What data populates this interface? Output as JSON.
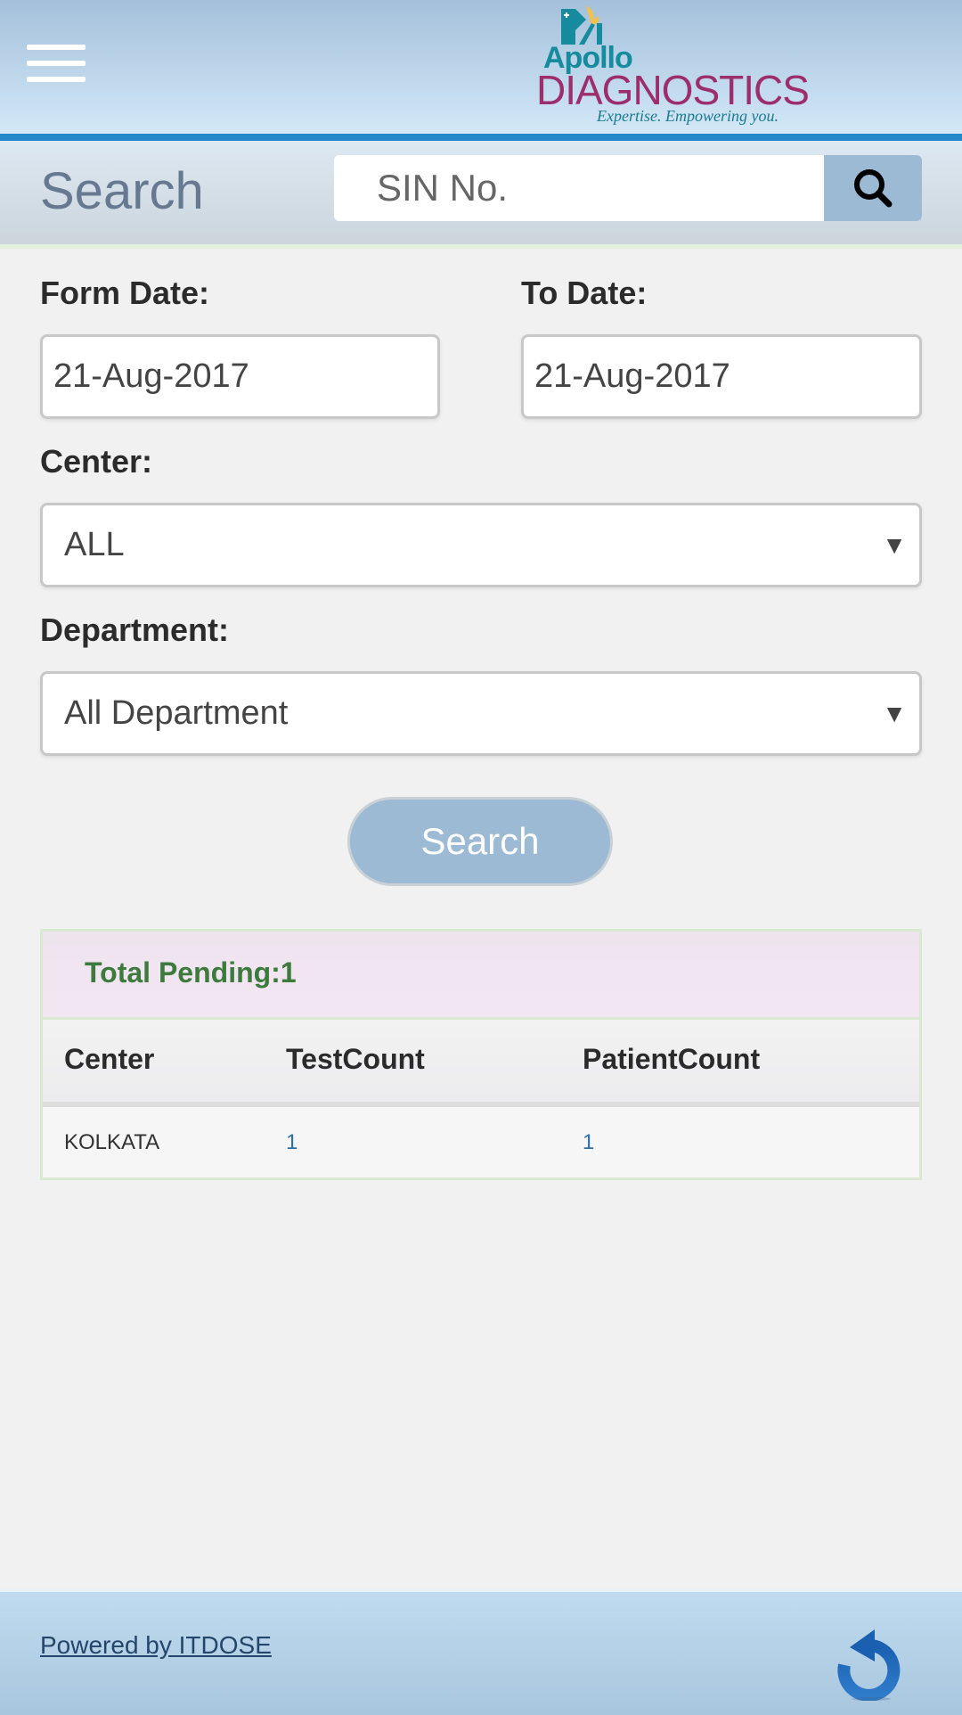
{
  "header": {
    "menu_icon": "hamburger-menu-icon",
    "logo": {
      "brand_top": "Apollo",
      "brand_main": "DIAGNOSTICS",
      "tagline": "Expertise. Empowering you.",
      "colors": {
        "teal": "#178b9e",
        "magenta": "#9d2e6c",
        "flame": "#f0c14b"
      }
    },
    "accent_bar_color": "#2389c8"
  },
  "search_strip": {
    "title": "Search",
    "sin_placeholder": "SIN No.",
    "sin_value": "",
    "search_icon": "search-icon"
  },
  "form": {
    "from_date_label": "Form Date:",
    "from_date_value": "21-Aug-2017",
    "to_date_label": "To Date:",
    "to_date_value": "21-Aug-2017",
    "center_label": "Center:",
    "center_value": "ALL",
    "department_label": "Department:",
    "department_value": "All Department",
    "dropdown_arrow": "▼",
    "search_button": "Search"
  },
  "results": {
    "total_pending": "Total Pending:1",
    "columns": [
      "Center",
      "TestCount",
      "PatientCount"
    ],
    "rows": [
      {
        "center": "KOLKATA",
        "test_count": "1",
        "patient_count": "1"
      }
    ]
  },
  "footer": {
    "powered_by": "Powered by ITDOSE",
    "refresh_icon": "refresh-icon"
  }
}
